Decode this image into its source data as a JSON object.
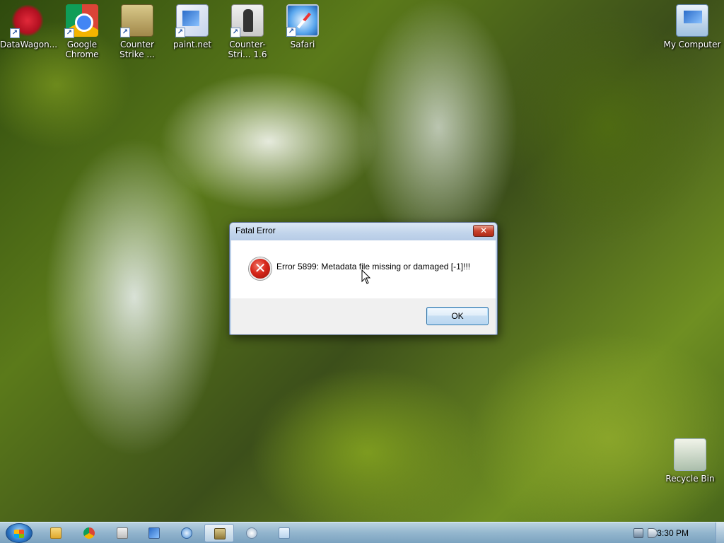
{
  "desktop": {
    "icons": [
      {
        "label": "DataWagon...",
        "icon": "datawagon-icon"
      },
      {
        "label": "Google Chrome",
        "icon": "chrome-icon"
      },
      {
        "label": "Counter Strike ...",
        "icon": "counter-strike-icon"
      },
      {
        "label": "paint.net",
        "icon": "paintnet-icon"
      },
      {
        "label": "Counter-Stri... 1.6",
        "icon": "counter-strike-16-icon"
      },
      {
        "label": "Safari",
        "icon": "safari-icon"
      },
      {
        "label": "My Computer",
        "icon": "my-computer-icon"
      },
      {
        "label": "Recycle Bin",
        "icon": "recycle-bin-icon"
      }
    ]
  },
  "dialog": {
    "title": "Fatal Error",
    "close_glyph": "✕",
    "icon": "error-icon",
    "error_glyph": "✕",
    "message": "Error 5899:  Metadata file missing or damaged [-1]!!!",
    "ok_label": "OK"
  },
  "taskbar": {
    "items": [
      "windows-explorer",
      "google-chrome",
      "counter-strike",
      "paint-net",
      "counter-strike-16",
      "safari",
      "notepad"
    ],
    "active_item": "counter-strike-16",
    "tray_icons": [
      "network-icon",
      "volume-icon"
    ],
    "clock": "3:30 PM"
  },
  "colors": {
    "dialog_frame": "#bcd0e8",
    "error_red": "#d6261a",
    "taskbar": "#96b9d7"
  }
}
